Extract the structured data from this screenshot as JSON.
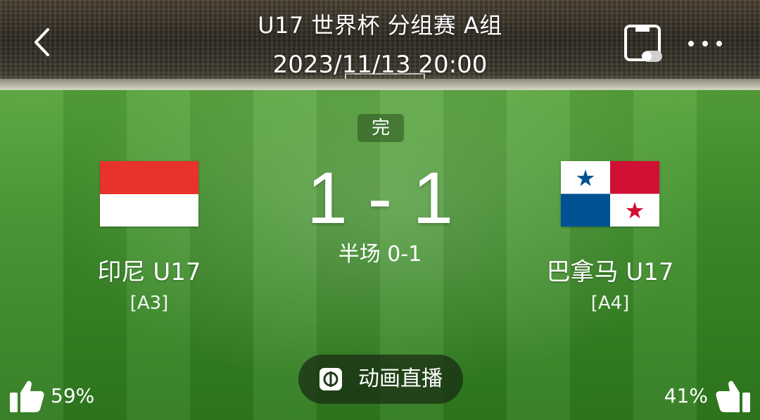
{
  "header": {
    "title": "U17 世界杯 分组赛 A组",
    "datetime": "2023/11/13 20:00"
  },
  "match": {
    "status": "完",
    "score": "1 - 1",
    "halftime": "半场 0-1"
  },
  "home": {
    "name": "印尼 U17",
    "group": "[A3]",
    "flag": "indonesia-flag",
    "vote_pct": "59%"
  },
  "away": {
    "name": "巴拿马 U17",
    "group": "[A4]",
    "flag": "panama-flag",
    "vote_pct": "41%"
  },
  "actions": {
    "live_label": "动画直播"
  },
  "icons": {
    "back": "chevron-left-icon",
    "pip": "picture-in-picture-icon",
    "more": "more-dots-icon",
    "live": "animation-live-icon",
    "thumbs_up": "thumbs-up-icon"
  },
  "colors": {
    "indonesia_red": "#e8332a",
    "panama_red": "#d21034",
    "panama_blue": "#005293",
    "pitch_green": "#3f8f2a"
  }
}
